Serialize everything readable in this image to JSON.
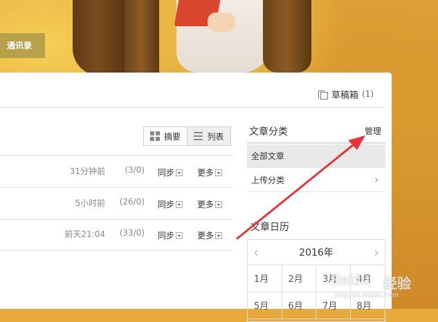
{
  "header": {
    "nav_contacts": "通讯录"
  },
  "drafts": {
    "label": "草稿箱",
    "count": "(1)"
  },
  "view_toggle": {
    "summary_label": "摘要",
    "list_label": "列表"
  },
  "articles": [
    {
      "time": "31分钟前",
      "count": "(3/0)",
      "sync": "同步",
      "more": "更多"
    },
    {
      "time": "5小时前",
      "count": "(26/0)",
      "sync": "同步",
      "more": "更多"
    },
    {
      "time": "前天21:04",
      "count": "(33/0)",
      "sync": "同步",
      "more": "更多"
    }
  ],
  "sidebar": {
    "category_title": "文章分类",
    "manage_label": "管理",
    "categories": [
      {
        "label": "全部文章"
      },
      {
        "label": "上传分类"
      }
    ],
    "calendar_title": "文章日历",
    "calendar": {
      "year": "2016年",
      "months_row1": [
        "1月",
        "2月",
        "3月",
        "4月"
      ],
      "months_row2": [
        "5月",
        "6月",
        "7月",
        "8月"
      ]
    }
  },
  "watermark": {
    "brand": "Baidu",
    "suffix": "经验",
    "url": "jingyan.baidu.com"
  },
  "colors": {
    "annotation_arrow": "#e8333a",
    "banner": "#e0a43a"
  }
}
